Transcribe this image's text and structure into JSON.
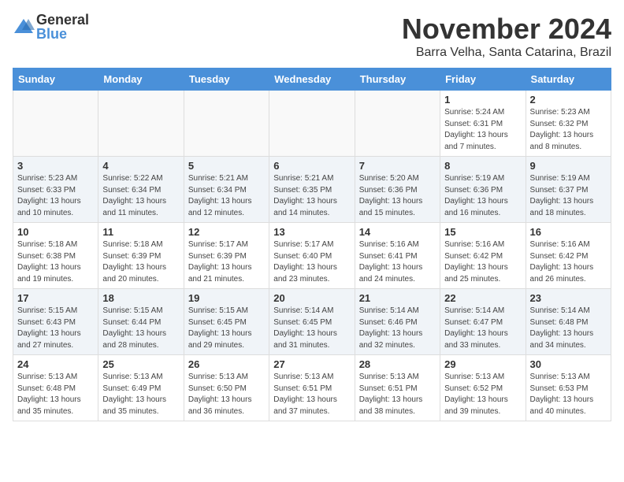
{
  "logo": {
    "general": "General",
    "blue": "Blue"
  },
  "title": "November 2024",
  "location": "Barra Velha, Santa Catarina, Brazil",
  "days_of_week": [
    "Sunday",
    "Monday",
    "Tuesday",
    "Wednesday",
    "Thursday",
    "Friday",
    "Saturday"
  ],
  "weeks": [
    [
      {
        "day": "",
        "info": ""
      },
      {
        "day": "",
        "info": ""
      },
      {
        "day": "",
        "info": ""
      },
      {
        "day": "",
        "info": ""
      },
      {
        "day": "",
        "info": ""
      },
      {
        "day": "1",
        "info": "Sunrise: 5:24 AM\nSunset: 6:31 PM\nDaylight: 13 hours and 7 minutes."
      },
      {
        "day": "2",
        "info": "Sunrise: 5:23 AM\nSunset: 6:32 PM\nDaylight: 13 hours and 8 minutes."
      }
    ],
    [
      {
        "day": "3",
        "info": "Sunrise: 5:23 AM\nSunset: 6:33 PM\nDaylight: 13 hours and 10 minutes."
      },
      {
        "day": "4",
        "info": "Sunrise: 5:22 AM\nSunset: 6:34 PM\nDaylight: 13 hours and 11 minutes."
      },
      {
        "day": "5",
        "info": "Sunrise: 5:21 AM\nSunset: 6:34 PM\nDaylight: 13 hours and 12 minutes."
      },
      {
        "day": "6",
        "info": "Sunrise: 5:21 AM\nSunset: 6:35 PM\nDaylight: 13 hours and 14 minutes."
      },
      {
        "day": "7",
        "info": "Sunrise: 5:20 AM\nSunset: 6:36 PM\nDaylight: 13 hours and 15 minutes."
      },
      {
        "day": "8",
        "info": "Sunrise: 5:19 AM\nSunset: 6:36 PM\nDaylight: 13 hours and 16 minutes."
      },
      {
        "day": "9",
        "info": "Sunrise: 5:19 AM\nSunset: 6:37 PM\nDaylight: 13 hours and 18 minutes."
      }
    ],
    [
      {
        "day": "10",
        "info": "Sunrise: 5:18 AM\nSunset: 6:38 PM\nDaylight: 13 hours and 19 minutes."
      },
      {
        "day": "11",
        "info": "Sunrise: 5:18 AM\nSunset: 6:39 PM\nDaylight: 13 hours and 20 minutes."
      },
      {
        "day": "12",
        "info": "Sunrise: 5:17 AM\nSunset: 6:39 PM\nDaylight: 13 hours and 21 minutes."
      },
      {
        "day": "13",
        "info": "Sunrise: 5:17 AM\nSunset: 6:40 PM\nDaylight: 13 hours and 23 minutes."
      },
      {
        "day": "14",
        "info": "Sunrise: 5:16 AM\nSunset: 6:41 PM\nDaylight: 13 hours and 24 minutes."
      },
      {
        "day": "15",
        "info": "Sunrise: 5:16 AM\nSunset: 6:42 PM\nDaylight: 13 hours and 25 minutes."
      },
      {
        "day": "16",
        "info": "Sunrise: 5:16 AM\nSunset: 6:42 PM\nDaylight: 13 hours and 26 minutes."
      }
    ],
    [
      {
        "day": "17",
        "info": "Sunrise: 5:15 AM\nSunset: 6:43 PM\nDaylight: 13 hours and 27 minutes."
      },
      {
        "day": "18",
        "info": "Sunrise: 5:15 AM\nSunset: 6:44 PM\nDaylight: 13 hours and 28 minutes."
      },
      {
        "day": "19",
        "info": "Sunrise: 5:15 AM\nSunset: 6:45 PM\nDaylight: 13 hours and 29 minutes."
      },
      {
        "day": "20",
        "info": "Sunrise: 5:14 AM\nSunset: 6:45 PM\nDaylight: 13 hours and 31 minutes."
      },
      {
        "day": "21",
        "info": "Sunrise: 5:14 AM\nSunset: 6:46 PM\nDaylight: 13 hours and 32 minutes."
      },
      {
        "day": "22",
        "info": "Sunrise: 5:14 AM\nSunset: 6:47 PM\nDaylight: 13 hours and 33 minutes."
      },
      {
        "day": "23",
        "info": "Sunrise: 5:14 AM\nSunset: 6:48 PM\nDaylight: 13 hours and 34 minutes."
      }
    ],
    [
      {
        "day": "24",
        "info": "Sunrise: 5:13 AM\nSunset: 6:48 PM\nDaylight: 13 hours and 35 minutes."
      },
      {
        "day": "25",
        "info": "Sunrise: 5:13 AM\nSunset: 6:49 PM\nDaylight: 13 hours and 35 minutes."
      },
      {
        "day": "26",
        "info": "Sunrise: 5:13 AM\nSunset: 6:50 PM\nDaylight: 13 hours and 36 minutes."
      },
      {
        "day": "27",
        "info": "Sunrise: 5:13 AM\nSunset: 6:51 PM\nDaylight: 13 hours and 37 minutes."
      },
      {
        "day": "28",
        "info": "Sunrise: 5:13 AM\nSunset: 6:51 PM\nDaylight: 13 hours and 38 minutes."
      },
      {
        "day": "29",
        "info": "Sunrise: 5:13 AM\nSunset: 6:52 PM\nDaylight: 13 hours and 39 minutes."
      },
      {
        "day": "30",
        "info": "Sunrise: 5:13 AM\nSunset: 6:53 PM\nDaylight: 13 hours and 40 minutes."
      }
    ]
  ]
}
